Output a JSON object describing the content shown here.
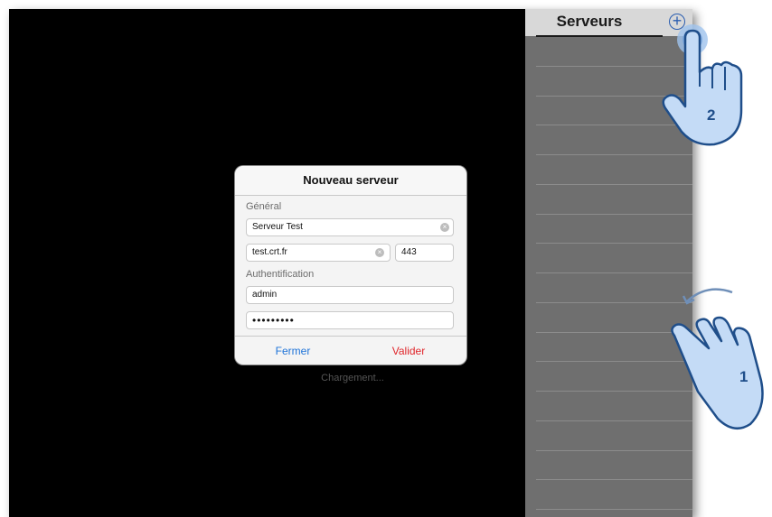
{
  "sidebar": {
    "title": "Serveurs",
    "add_icon": "plus-circle-icon"
  },
  "dialog": {
    "title": "Nouveau serveur",
    "general_label": "Général",
    "server_name": "Serveur Test",
    "host": "test.crt.fr",
    "port": "443",
    "auth_label": "Authentification",
    "username": "admin",
    "password_mask": "•••••••••",
    "close_label": "Fermer",
    "validate_label": "Valider"
  },
  "loading_text": "Chargement...",
  "annotations": {
    "step1": "1",
    "step2": "2"
  },
  "colors": {
    "accent_blue": "#1e73d8",
    "danger_red": "#e0262b",
    "hand_fill": "#c4dbf6",
    "hand_stroke": "#1f4e8a"
  }
}
